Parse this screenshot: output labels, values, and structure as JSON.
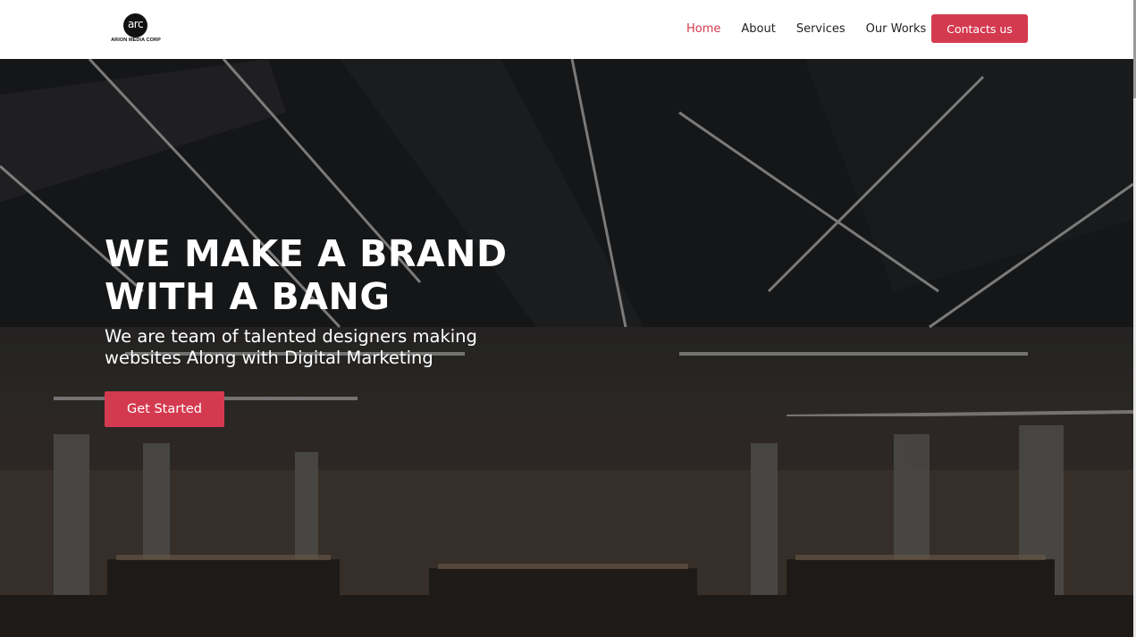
{
  "brand": {
    "logo_mark": "arc",
    "logo_text": "ARION MEDIA CORP"
  },
  "nav": {
    "items": [
      {
        "label": "Home",
        "active": true
      },
      {
        "label": "About",
        "active": false
      },
      {
        "label": "Services",
        "active": false
      },
      {
        "label": "Our Works",
        "active": false
      }
    ],
    "contact_label": "Contacts us"
  },
  "hero": {
    "title_line1": "WE MAKE A BRAND",
    "title_line2": "WITH A BANG",
    "subtitle_line1": "We are team of talented designers making",
    "subtitle_line2": "websites Along with Digital Marketing",
    "cta_label": "Get Started",
    "background": "office-interior-photo"
  },
  "colors": {
    "accent": "#d43a4f",
    "active_nav": "#d13a4e",
    "header_bg": "#ffffff"
  }
}
